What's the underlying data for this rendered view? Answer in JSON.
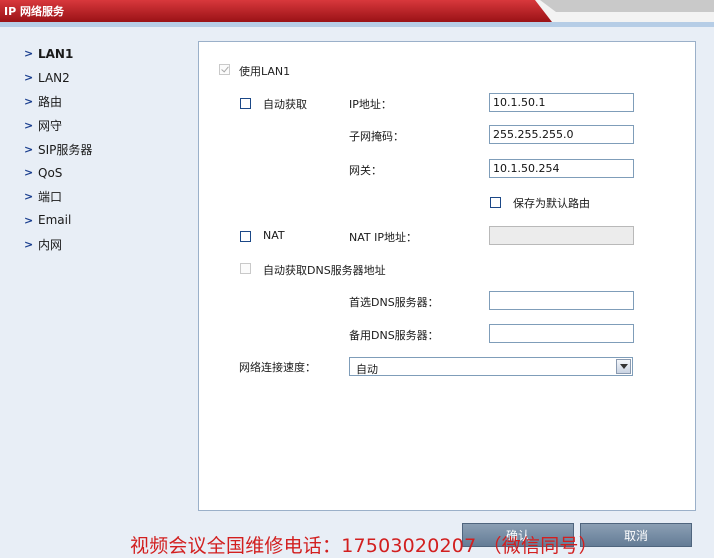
{
  "window": {
    "title": "IP 网络服务"
  },
  "nav": {
    "items": [
      {
        "label": "LAN1",
        "active": true
      },
      {
        "label": "LAN2"
      },
      {
        "label": "路由"
      },
      {
        "label": "网守"
      },
      {
        "label": "SIP服务器"
      },
      {
        "label": "QoS"
      },
      {
        "label": "端口"
      },
      {
        "label": "Email"
      },
      {
        "label": "内网"
      }
    ]
  },
  "form": {
    "use_lan1": {
      "label": "使用LAN1",
      "checked": true
    },
    "auto_obtain": {
      "label": "自动获取",
      "checked": false
    },
    "ip_address": {
      "label": "IP地址：",
      "value": "10.1.50.1"
    },
    "subnet_mask": {
      "label": "子网掩码：",
      "value": "255.255.255.0"
    },
    "gateway": {
      "label": "网关：",
      "value": "10.1.50.254"
    },
    "save_default_route": {
      "label": "保存为默认路由",
      "checked": false
    },
    "nat": {
      "label": "NAT",
      "checked": false
    },
    "nat_ip": {
      "label": "NAT IP地址：",
      "value": ""
    },
    "auto_dns": {
      "label": "自动获取DNS服务器地址",
      "checked": false
    },
    "primary_dns": {
      "label": "首选DNS服务器：",
      "value": ""
    },
    "secondary_dns": {
      "label": "备用DNS服务器：",
      "value": ""
    },
    "link_speed": {
      "label": "网络连接速度：",
      "value": "自动"
    }
  },
  "buttons": {
    "confirm": "确认",
    "cancel": "取消"
  },
  "watermark": "视频会议全国维修电话：17503020207 （微信同号）"
}
